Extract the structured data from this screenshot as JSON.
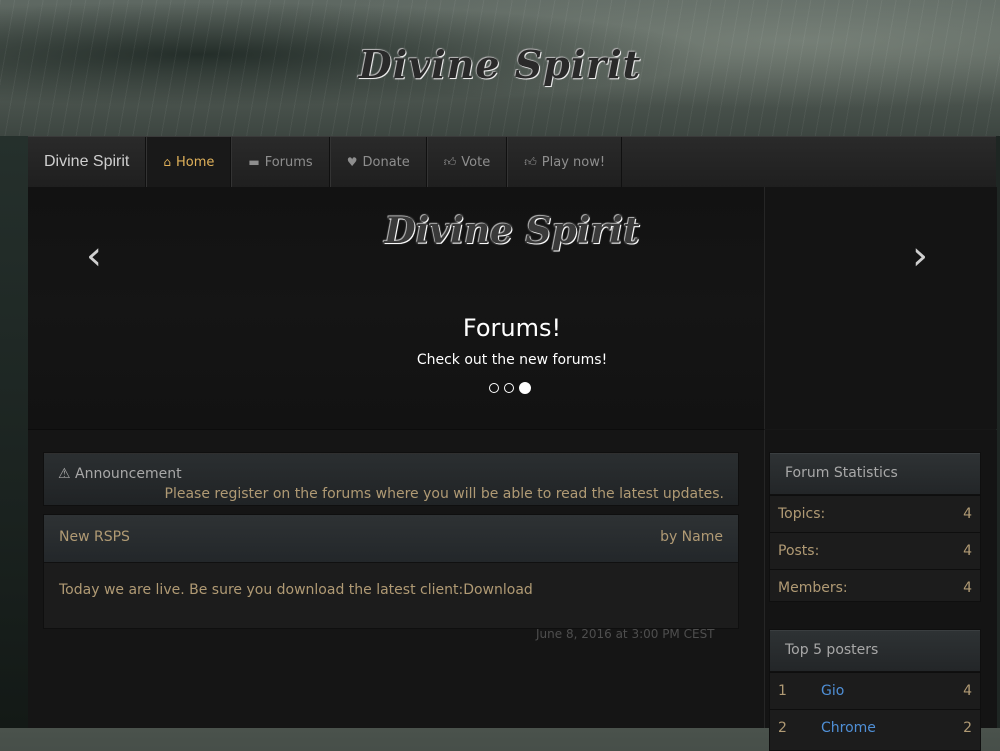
{
  "site": {
    "logo": "Divine Spirit"
  },
  "nav": {
    "brand": "Divine Spirit",
    "items": [
      {
        "label": "Home",
        "icon": "home-icon",
        "active": true
      },
      {
        "label": "Forums",
        "icon": "comment-icon"
      },
      {
        "label": "Donate",
        "icon": "heart-icon"
      },
      {
        "label": "Vote",
        "icon": "thumbs-up-icon"
      },
      {
        "label": "Play now!",
        "icon": "thumbs-up-icon"
      }
    ]
  },
  "carousel": {
    "logo": "Divine Spirit",
    "title": "Forums!",
    "text": "Check out the new forums!",
    "slide_count": 3,
    "active_slide": 3
  },
  "announcement": {
    "title": "Announcement",
    "body": "Please register on the forums where you will be able to read the latest updates."
  },
  "news": {
    "title": "New RSPS",
    "author": "by Name",
    "body": "Today we are live. Be sure you download the latest client:",
    "link": "Download",
    "date": "June 8, 2016 at 3:00 PM CEST"
  },
  "stats": {
    "title": "Forum Statistics",
    "rows": [
      {
        "label": "Topics:",
        "value": "4"
      },
      {
        "label": "Posts:",
        "value": "4"
      },
      {
        "label": "Members:",
        "value": "4"
      }
    ]
  },
  "posters": {
    "title": "Top 5 posters",
    "rows": [
      {
        "rank": "1",
        "name": "Gio",
        "value": "4"
      },
      {
        "rank": "2",
        "name": "Chrome",
        "value": "2"
      }
    ]
  },
  "colors": {
    "accent": "#e0b15a",
    "text": "#b09a74",
    "link": "#4f8fd6"
  }
}
